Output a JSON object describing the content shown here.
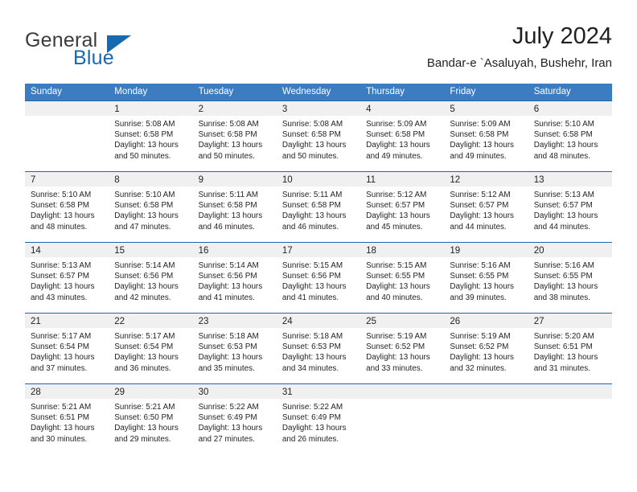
{
  "brand": {
    "word_general": "General",
    "word_blue": "Blue",
    "accent_color": "#1769b0",
    "flag_icon": "triangle-flag-icon"
  },
  "header": {
    "title": "July 2024",
    "subtitle": "Bandar-e `Asaluyah, Bushehr, Iran"
  },
  "calendar": {
    "header_bg": "#3b7dc0",
    "row_rule_color": "#1f66ae",
    "day_band_bg": "#f0f0f0",
    "weekdays": [
      "Sunday",
      "Monday",
      "Tuesday",
      "Wednesday",
      "Thursday",
      "Friday",
      "Saturday"
    ],
    "weeks": [
      [
        {
          "day": "",
          "lines": []
        },
        {
          "day": "1",
          "lines": [
            "Sunrise: 5:08 AM",
            "Sunset: 6:58 PM",
            "Daylight: 13 hours",
            "and 50 minutes."
          ]
        },
        {
          "day": "2",
          "lines": [
            "Sunrise: 5:08 AM",
            "Sunset: 6:58 PM",
            "Daylight: 13 hours",
            "and 50 minutes."
          ]
        },
        {
          "day": "3",
          "lines": [
            "Sunrise: 5:08 AM",
            "Sunset: 6:58 PM",
            "Daylight: 13 hours",
            "and 50 minutes."
          ]
        },
        {
          "day": "4",
          "lines": [
            "Sunrise: 5:09 AM",
            "Sunset: 6:58 PM",
            "Daylight: 13 hours",
            "and 49 minutes."
          ]
        },
        {
          "day": "5",
          "lines": [
            "Sunrise: 5:09 AM",
            "Sunset: 6:58 PM",
            "Daylight: 13 hours",
            "and 49 minutes."
          ]
        },
        {
          "day": "6",
          "lines": [
            "Sunrise: 5:10 AM",
            "Sunset: 6:58 PM",
            "Daylight: 13 hours",
            "and 48 minutes."
          ]
        }
      ],
      [
        {
          "day": "7",
          "lines": [
            "Sunrise: 5:10 AM",
            "Sunset: 6:58 PM",
            "Daylight: 13 hours",
            "and 48 minutes."
          ]
        },
        {
          "day": "8",
          "lines": [
            "Sunrise: 5:10 AM",
            "Sunset: 6:58 PM",
            "Daylight: 13 hours",
            "and 47 minutes."
          ]
        },
        {
          "day": "9",
          "lines": [
            "Sunrise: 5:11 AM",
            "Sunset: 6:58 PM",
            "Daylight: 13 hours",
            "and 46 minutes."
          ]
        },
        {
          "day": "10",
          "lines": [
            "Sunrise: 5:11 AM",
            "Sunset: 6:58 PM",
            "Daylight: 13 hours",
            "and 46 minutes."
          ]
        },
        {
          "day": "11",
          "lines": [
            "Sunrise: 5:12 AM",
            "Sunset: 6:57 PM",
            "Daylight: 13 hours",
            "and 45 minutes."
          ]
        },
        {
          "day": "12",
          "lines": [
            "Sunrise: 5:12 AM",
            "Sunset: 6:57 PM",
            "Daylight: 13 hours",
            "and 44 minutes."
          ]
        },
        {
          "day": "13",
          "lines": [
            "Sunrise: 5:13 AM",
            "Sunset: 6:57 PM",
            "Daylight: 13 hours",
            "and 44 minutes."
          ]
        }
      ],
      [
        {
          "day": "14",
          "lines": [
            "Sunrise: 5:13 AM",
            "Sunset: 6:57 PM",
            "Daylight: 13 hours",
            "and 43 minutes."
          ]
        },
        {
          "day": "15",
          "lines": [
            "Sunrise: 5:14 AM",
            "Sunset: 6:56 PM",
            "Daylight: 13 hours",
            "and 42 minutes."
          ]
        },
        {
          "day": "16",
          "lines": [
            "Sunrise: 5:14 AM",
            "Sunset: 6:56 PM",
            "Daylight: 13 hours",
            "and 41 minutes."
          ]
        },
        {
          "day": "17",
          "lines": [
            "Sunrise: 5:15 AM",
            "Sunset: 6:56 PM",
            "Daylight: 13 hours",
            "and 41 minutes."
          ]
        },
        {
          "day": "18",
          "lines": [
            "Sunrise: 5:15 AM",
            "Sunset: 6:55 PM",
            "Daylight: 13 hours",
            "and 40 minutes."
          ]
        },
        {
          "day": "19",
          "lines": [
            "Sunrise: 5:16 AM",
            "Sunset: 6:55 PM",
            "Daylight: 13 hours",
            "and 39 minutes."
          ]
        },
        {
          "day": "20",
          "lines": [
            "Sunrise: 5:16 AM",
            "Sunset: 6:55 PM",
            "Daylight: 13 hours",
            "and 38 minutes."
          ]
        }
      ],
      [
        {
          "day": "21",
          "lines": [
            "Sunrise: 5:17 AM",
            "Sunset: 6:54 PM",
            "Daylight: 13 hours",
            "and 37 minutes."
          ]
        },
        {
          "day": "22",
          "lines": [
            "Sunrise: 5:17 AM",
            "Sunset: 6:54 PM",
            "Daylight: 13 hours",
            "and 36 minutes."
          ]
        },
        {
          "day": "23",
          "lines": [
            "Sunrise: 5:18 AM",
            "Sunset: 6:53 PM",
            "Daylight: 13 hours",
            "and 35 minutes."
          ]
        },
        {
          "day": "24",
          "lines": [
            "Sunrise: 5:18 AM",
            "Sunset: 6:53 PM",
            "Daylight: 13 hours",
            "and 34 minutes."
          ]
        },
        {
          "day": "25",
          "lines": [
            "Sunrise: 5:19 AM",
            "Sunset: 6:52 PM",
            "Daylight: 13 hours",
            "and 33 minutes."
          ]
        },
        {
          "day": "26",
          "lines": [
            "Sunrise: 5:19 AM",
            "Sunset: 6:52 PM",
            "Daylight: 13 hours",
            "and 32 minutes."
          ]
        },
        {
          "day": "27",
          "lines": [
            "Sunrise: 5:20 AM",
            "Sunset: 6:51 PM",
            "Daylight: 13 hours",
            "and 31 minutes."
          ]
        }
      ],
      [
        {
          "day": "28",
          "lines": [
            "Sunrise: 5:21 AM",
            "Sunset: 6:51 PM",
            "Daylight: 13 hours",
            "and 30 minutes."
          ]
        },
        {
          "day": "29",
          "lines": [
            "Sunrise: 5:21 AM",
            "Sunset: 6:50 PM",
            "Daylight: 13 hours",
            "and 29 minutes."
          ]
        },
        {
          "day": "30",
          "lines": [
            "Sunrise: 5:22 AM",
            "Sunset: 6:49 PM",
            "Daylight: 13 hours",
            "and 27 minutes."
          ]
        },
        {
          "day": "31",
          "lines": [
            "Sunrise: 5:22 AM",
            "Sunset: 6:49 PM",
            "Daylight: 13 hours",
            "and 26 minutes."
          ]
        },
        {
          "day": "",
          "lines": []
        },
        {
          "day": "",
          "lines": []
        },
        {
          "day": "",
          "lines": []
        }
      ]
    ]
  }
}
